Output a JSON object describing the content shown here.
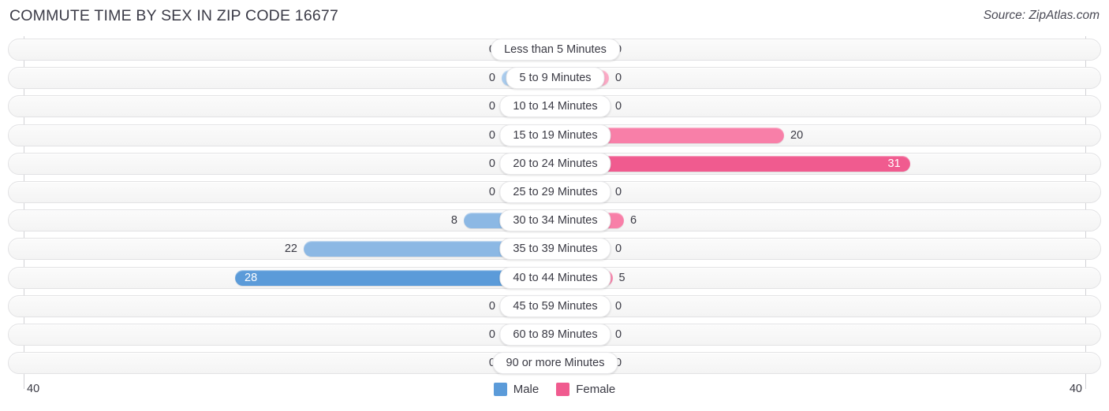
{
  "header": {
    "title": "COMMUTE TIME BY SEX IN ZIP CODE 16677",
    "source": "Source: ZipAtlas.com"
  },
  "legend": {
    "male_label": "Male",
    "female_label": "Female",
    "male_color": "#5b9bd9",
    "female_color": "#f05b8f"
  },
  "axis": {
    "left_tick": "40",
    "right_tick": "40"
  },
  "colors": {
    "male_light": "#a8cbed",
    "male_strong": "#5b9bd9",
    "female_light": "#fba8c4",
    "female_strong": "#f05b8f",
    "track": "#f6f6f6"
  },
  "chart_data": {
    "type": "bar",
    "title": "COMMUTE TIME BY SEX IN ZIP CODE 16677",
    "subtitle": "Source: ZipAtlas.com",
    "orientation": "horizontal-diverging",
    "xlabel": "",
    "ylabel": "",
    "xlim": [
      -40,
      40
    ],
    "axis_ticks": [
      "40",
      "40"
    ],
    "grid": false,
    "legend_position": "bottom-center",
    "categories": [
      "Less than 5 Minutes",
      "5 to 9 Minutes",
      "10 to 14 Minutes",
      "15 to 19 Minutes",
      "20 to 24 Minutes",
      "25 to 29 Minutes",
      "30 to 34 Minutes",
      "35 to 39 Minutes",
      "40 to 44 Minutes",
      "45 to 59 Minutes",
      "60 to 89 Minutes",
      "90 or more Minutes"
    ],
    "series": [
      {
        "name": "Male",
        "values": [
          0,
          0,
          0,
          0,
          0,
          0,
          8,
          22,
          28,
          0,
          0,
          0
        ],
        "labels": [
          "0",
          "0",
          "0",
          "0",
          "0",
          "0",
          "8",
          "22",
          "28",
          "0",
          "0",
          "0"
        ]
      },
      {
        "name": "Female",
        "values": [
          0,
          0,
          0,
          20,
          31,
          0,
          6,
          0,
          5,
          0,
          0,
          0
        ],
        "labels": [
          "0",
          "0",
          "0",
          "20",
          "31",
          "0",
          "6",
          "0",
          "5",
          "0",
          "0",
          "0"
        ]
      }
    ]
  }
}
